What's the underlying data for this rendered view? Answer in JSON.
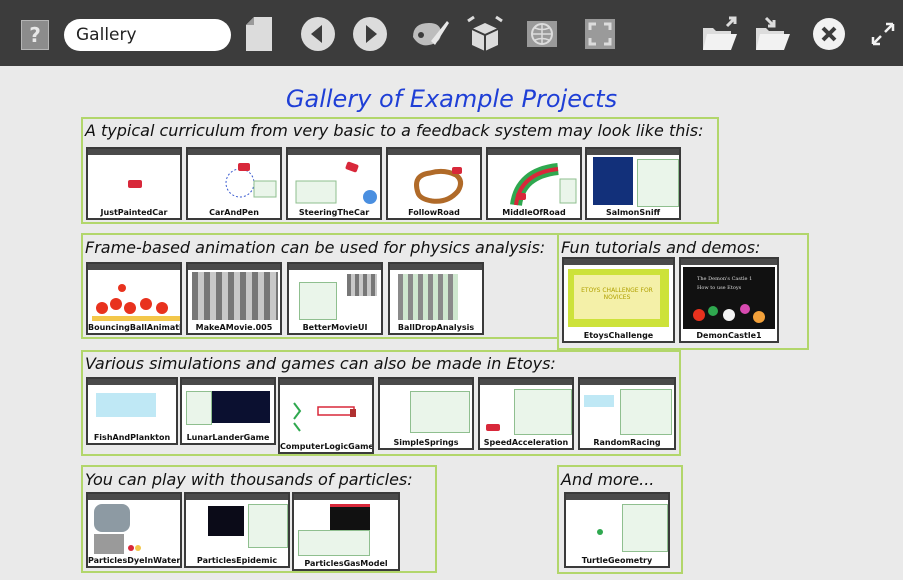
{
  "toolbar": {
    "help_label": "?",
    "project_title": "Gallery"
  },
  "page": {
    "heading": "Gallery of Example Projects"
  },
  "groups": {
    "curriculum": {
      "title": "A typical curriculum from very basic to a feedback system may look like this:",
      "projects": [
        "JustPaintedCar",
        "CarAndPen",
        "SteeringTheCar",
        "FollowRoad",
        "MiddleOfRoad",
        "SalmonSniff"
      ]
    },
    "animation": {
      "title": "Frame-based animation can be used for physics analysis:",
      "projects": [
        "BouncingBallAnimation",
        "MakeAMovie.005",
        "BetterMovieUI",
        "BallDropAnalysis"
      ]
    },
    "tutorials": {
      "title": "Fun tutorials and demos:",
      "projects": [
        "EtoysChallenge",
        "DemonCastle1"
      ],
      "challenge_text": "ETOYS CHALLENGE FOR NOVICES",
      "demon_text": "The Demon's Castle 1 How to use Etoys"
    },
    "simulations": {
      "title": "Various simulations and games can also be made in Etoys:",
      "projects": [
        "FishAndPlankton",
        "LunarLanderGame",
        "ComputerLogicGame",
        "SimpleSprings",
        "SpeedAcceleration",
        "RandomRacing"
      ]
    },
    "particles": {
      "title": "You can play with thousands of particles:",
      "projects": [
        "ParticlesDyeInWater",
        "ParticlesEpidemic",
        "ParticlesGasModel"
      ]
    },
    "more": {
      "title": "And more...",
      "projects": [
        "TurtleGeometry"
      ]
    }
  },
  "colors": {
    "toolbar": "#3c3c3c",
    "heading": "#1f3fd6",
    "group_border": "#b2d66b",
    "page_background": "#eaeaea"
  }
}
